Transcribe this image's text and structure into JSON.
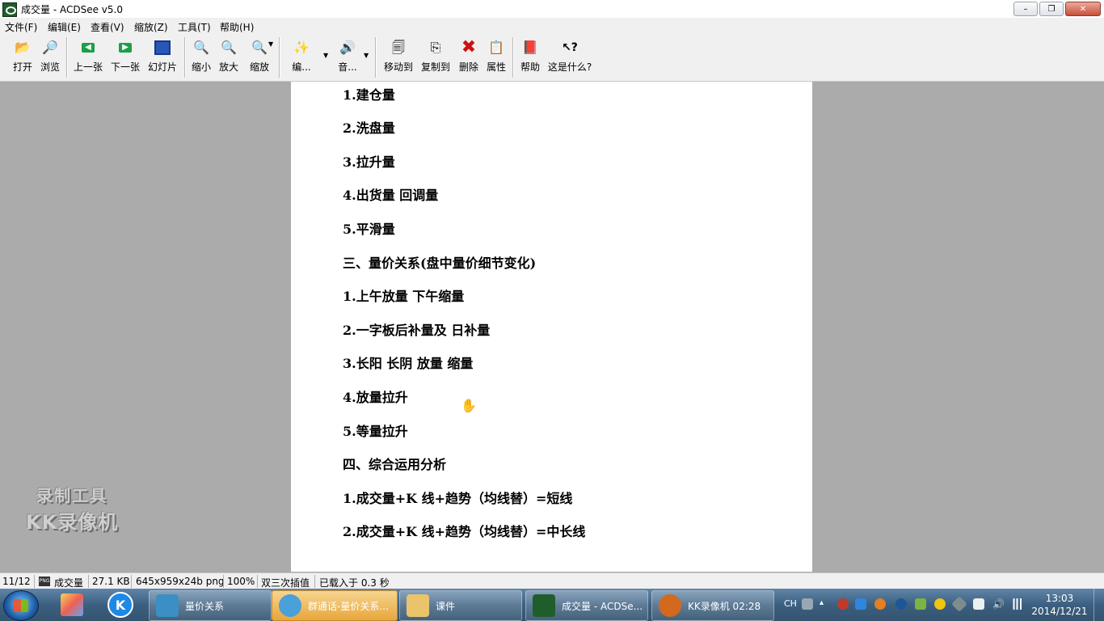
{
  "window": {
    "title": "成交量 - ACDSee v5.0",
    "minimize": "–",
    "maximize": "❐",
    "close": "✕"
  },
  "menu": [
    "文件(F)",
    "编辑(E)",
    "查看(V)",
    "缩放(Z)",
    "工具(T)",
    "帮助(H)"
  ],
  "toolbar": {
    "open": "打开",
    "browse": "浏览",
    "prev": "上一张",
    "next": "下一张",
    "slideshow": "幻灯片",
    "zoom_out": "缩小",
    "zoom_in": "放大",
    "zoom": "缩放",
    "edit": "编...",
    "audio": "音...",
    "move_to": "移动到",
    "copy_to": "复制到",
    "delete": "删除",
    "properties": "属性",
    "help": "帮助",
    "whats_this": "这是什么?"
  },
  "document": {
    "lines": [
      "1.建仓量",
      "2.洗盘量",
      "3.拉升量",
      "4.出货量  回调量",
      "5.平滑量",
      "三、量价关系(盘中量价细节变化)",
      "1.上午放量  下午缩量",
      "2.一字板后补量及  日补量",
      "3.长阳  长阴  放量  缩量",
      "4.放量拉升",
      "5.等量拉升",
      "四、综合运用分析",
      "1.成交量+K 线+趋势（均线替）=短线",
      "2.成交量+K 线+趋势（均线替）=中长线"
    ]
  },
  "watermark": {
    "line1": "录制工具",
    "line2": "KK录像机"
  },
  "status": {
    "index": "11/12",
    "filename": "成交量",
    "filesize": "27.1 KB",
    "dimensions": "645x959x24b png",
    "zoom": "100%",
    "interpolation": "双三次插值",
    "loaded": "已载入于 0.3 秒"
  },
  "taskbar": {
    "tasks": [
      {
        "label": "量价关系",
        "color": "#3b8fc4"
      },
      {
        "label": "群通话-量价关系...",
        "color": "#4aa0d8"
      },
      {
        "label": "课件",
        "color": "#e9c46a"
      },
      {
        "label": "成交量 - ACDSe...",
        "color": "#1f5e2b"
      },
      {
        "label": "KK录像机 02:28",
        "color": "#d2691e"
      }
    ],
    "tray_lang": "CH",
    "time": "13:03",
    "date": "2014/12/21"
  }
}
